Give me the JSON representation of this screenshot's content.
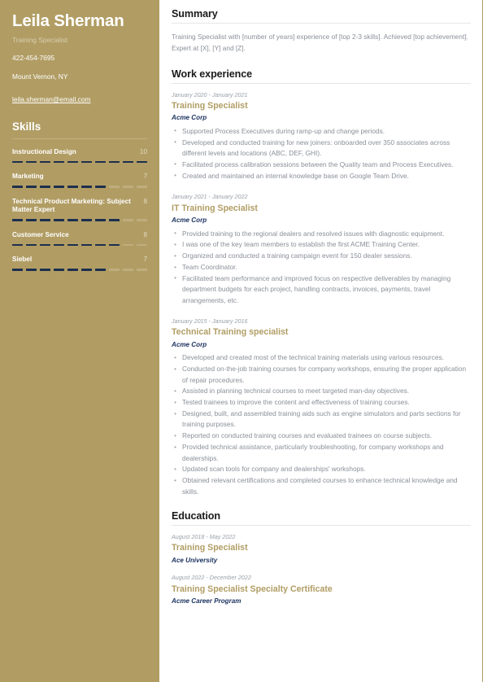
{
  "colors": {
    "sidebar_bg": "#b19d64",
    "accent_gold": "#b19d64",
    "navy": "#1d3461",
    "skill_filled": "#1d2f4f",
    "skill_empty": "#bfad7d",
    "body_text": "#8a8f98"
  },
  "sidebar": {
    "name": "Leila Sherman",
    "job_subtitle": "Training Specialist",
    "phone": "422-454-7695",
    "location": "Mount Vernon, NY",
    "email": "leila.sherman@email.com",
    "skills_heading": "Skills",
    "skills_max": 10,
    "skills": [
      {
        "label": "Instructional Design",
        "value": 10
      },
      {
        "label": "Marketing",
        "value": 7
      },
      {
        "label": "Technical Product Marketing: Subject Matter Expert",
        "value": 8
      },
      {
        "label": "Customer Service",
        "value": 8
      },
      {
        "label": "Siebel",
        "value": 7
      }
    ]
  },
  "main": {
    "summary_heading": "Summary",
    "summary_text": "Training Specialist with [number of years] experience of [top 2-3 skills]. Achieved [top achievement]. Expert at [X], [Y] and [Z].",
    "work_heading": "Work experience",
    "jobs": [
      {
        "dates": "January 2020 - January 2021",
        "title": "Training Specialist",
        "company": "Acme Corp",
        "bullets": [
          "Supported Process Executives during ramp-up and change periods.",
          "Developed and conducted training for new joiners: onboarded over 350 associates across different levels and locations (ABC, DEF, GHI).",
          "Facilitated process calibration sessions between the Quality team and Process Executives.",
          "Created and maintained an internal knowledge base on Google Team Drive."
        ]
      },
      {
        "dates": "January 2021 - January 2022",
        "title": "IT Training Specialist",
        "company": "Acme Corp",
        "bullets": [
          "Provided training to the regional dealers and resolved issues with diagnostic equipment.",
          "I was one of the key team members to establish the first ACME Training Center.",
          "Organized and conducted a training campaign event for 150 dealer sessions.",
          "Team Coordinator.",
          "Facilitated team performance and improved focus on respective deliverables by managing department budgets for each project, handling contracts, invoices, payments, travel arrangements, etc."
        ]
      },
      {
        "dates": "January 2015 - January 2016",
        "title": "Technical Training specialist",
        "company": "Acme Corp",
        "bullets": [
          "Developed and created most of the technical training materials using various resources.",
          "Conducted on-the-job training courses for company workshops, ensuring the proper application of repair procedures.",
          "Assisted in planning technical courses to meet targeted man-day objectives.",
          "Tested trainees to improve the content and effectiveness of training courses.",
          "Designed, built, and assembled training aids such as engine simulators and parts sections for training purposes.",
          "Reported on conducted training courses and evaluated trainees on course subjects.",
          "Provided technical assistance, particularly troubleshooting, for company workshops and dealerships.",
          "Updated scan tools for company and dealerships' workshops.",
          "Obtained relevant certifications and completed courses to enhance technical knowledge and skills."
        ]
      }
    ],
    "education_heading": "Education",
    "education": [
      {
        "dates": "August 2018 - May 2022",
        "title": "Training Specialist",
        "org": "Ace University"
      },
      {
        "dates": "August 2022 - December 2022",
        "title": "Training Specialist Specialty Certificate",
        "org": "Acme Career Program"
      }
    ]
  }
}
